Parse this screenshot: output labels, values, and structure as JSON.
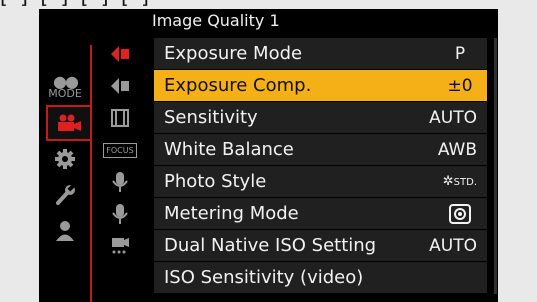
{
  "page": {
    "top_clipped_text": "[ ] [ ] [ ] [ ]"
  },
  "header": {
    "title": "Image Quality 1"
  },
  "main_categories": [
    {
      "name": "mode",
      "label": "MODE",
      "active": false
    },
    {
      "name": "video-camera",
      "active": true
    },
    {
      "name": "gear",
      "active": false
    },
    {
      "name": "wrench",
      "active": false
    },
    {
      "name": "person",
      "active": false
    }
  ],
  "sub_tabs": [
    {
      "name": "image-quality-1",
      "active": true
    },
    {
      "name": "image-quality-2",
      "active": false
    },
    {
      "name": "image-format",
      "active": false
    },
    {
      "name": "focus",
      "active": false,
      "label": "FOCUS"
    },
    {
      "name": "audio-1",
      "active": false
    },
    {
      "name": "audio-2",
      "active": false
    },
    {
      "name": "other",
      "active": false
    }
  ],
  "menu": {
    "items": [
      {
        "label": "Exposure Mode",
        "value": "P"
      },
      {
        "label": "Exposure Comp.",
        "value": "±0",
        "selected": true
      },
      {
        "label": "Sensitivity",
        "value": "AUTO"
      },
      {
        "label": "White Balance",
        "value": "AWB"
      },
      {
        "label": "Photo Style",
        "value": "STD."
      },
      {
        "label": "Metering Mode",
        "value": ""
      },
      {
        "label": "Dual Native ISO Setting",
        "value": "AUTO"
      },
      {
        "label": "ISO Sensitivity (video)",
        "value": ""
      }
    ]
  },
  "colors": {
    "accent": "#f5b018",
    "active_red": "#c41a1a",
    "row_bg": "#202020"
  }
}
